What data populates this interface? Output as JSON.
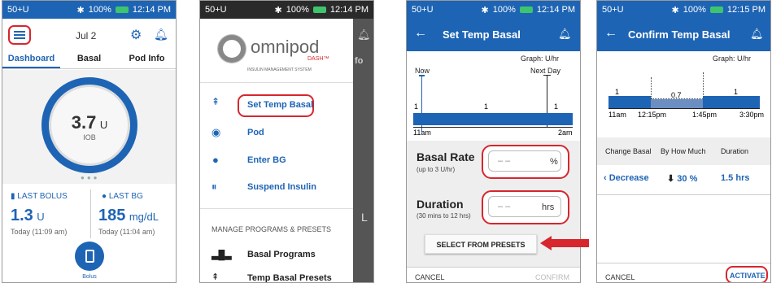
{
  "screens": [
    {
      "status": {
        "left": "50+U",
        "battery": "100%",
        "time": "12:14 PM"
      },
      "header_date": "Jul 2",
      "tabs": [
        "Dashboard",
        "Basal",
        "Pod Info"
      ],
      "iob_value": "3.7",
      "iob_unit": "U",
      "iob_label": "IOB",
      "last_bolus_label": "LAST BOLUS",
      "last_bolus_value": "1.3",
      "last_bolus_unit": "U",
      "last_bolus_time": "Today (11:09 am)",
      "last_bg_label": "LAST BG",
      "last_bg_value": "185",
      "last_bg_unit": "mg/dL",
      "last_bg_time": "Today (11:04 am)",
      "bolus_label": "Bolus"
    },
    {
      "status": {
        "left": "50+U",
        "battery": "100%",
        "time": "12:14 PM"
      },
      "logo_text": "omnipod",
      "logo_dash": "DASH™",
      "logo_sub": "INSULIN MANAGEMENT SYSTEM",
      "menu": [
        "Set Temp Basal",
        "Pod",
        "Enter BG",
        "Suspend Insulin"
      ],
      "section_label": "MANAGE PROGRAMS & PRESETS",
      "section_items": [
        "Basal Programs",
        "Temp Basal Presets"
      ],
      "behind_tab": "fo",
      "behind_letter": "L"
    },
    {
      "status": {
        "left": "50+U",
        "battery": "100%",
        "time": "12:14 PM"
      },
      "title": "Set Temp Basal",
      "graph_label": "Graph: U/hr",
      "now_label": "Now",
      "next_day_label": "Next Day",
      "graph_values": [
        "1",
        "1",
        "1"
      ],
      "time_start": "11am",
      "time_end": "2am",
      "basal_rate_label": "Basal Rate",
      "basal_rate_hint": "(up to 3 U/hr)",
      "basal_rate_placeholder": "– –",
      "basal_rate_unit": "%",
      "duration_label": "Duration",
      "duration_hint": "(30 mins to 12 hrs)",
      "duration_placeholder": "– –",
      "duration_unit": "hrs",
      "presets_button": "SELECT FROM PRESETS",
      "cancel": "CANCEL",
      "confirm": "CONFIRM"
    },
    {
      "status": {
        "left": "50+U",
        "battery": "100%",
        "time": "12:15 PM"
      },
      "title": "Confirm Temp Basal",
      "graph_label": "Graph: U/hr",
      "graph_values": [
        "1",
        "0.7",
        "1"
      ],
      "times": [
        "11am",
        "12:15pm",
        "1:45pm",
        "3:30pm"
      ],
      "col_headers": [
        "Change Basal",
        "By How Much",
        "Duration"
      ],
      "change_value": "Decrease",
      "amount_value": "30 %",
      "duration_value": "1.5 hrs",
      "cancel": "CANCEL",
      "activate": "ACTIVATE"
    }
  ],
  "colors": {
    "primary": "#1e64b4",
    "highlight": "#d7262e",
    "battery": "#3ec46d"
  }
}
